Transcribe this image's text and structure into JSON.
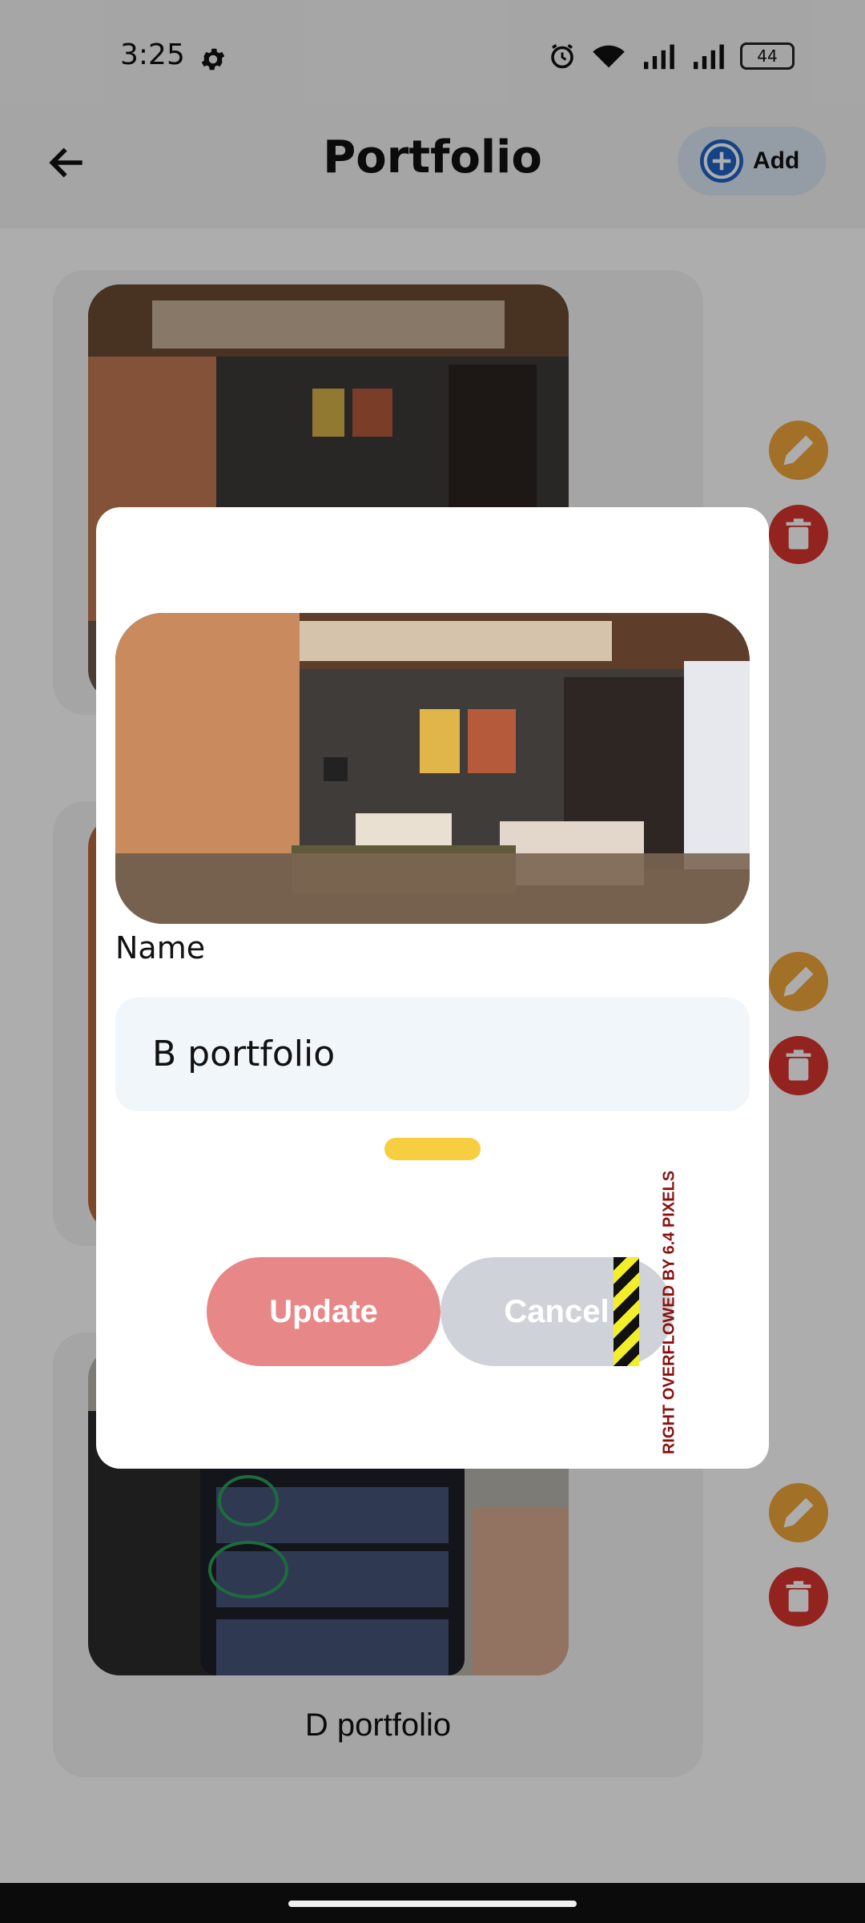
{
  "status": {
    "time": "3:25",
    "battery": "44"
  },
  "app_bar": {
    "title": "Portfolio",
    "add_label": "Add"
  },
  "cards": [
    {
      "name": ""
    },
    {
      "name": ""
    },
    {
      "name": "D portfolio"
    }
  ],
  "dialog": {
    "name_label": "Name",
    "name_value": "B portfolio",
    "update_label": "Update",
    "cancel_label": "Cancel",
    "overflow_message": "RIGHT OVERFLOWED BY 6.4 PIXELS"
  },
  "colors": {
    "accent_blue": "#1f63c9",
    "edit": "#f0a63a",
    "delete": "#d8342f",
    "update_button": "#e88787",
    "cancel_button": "#cfd3d9",
    "pill": "#f6ce3f"
  },
  "icons": [
    "gear-icon",
    "alarm-icon",
    "wifi-icon",
    "signal-icon",
    "back-arrow-icon",
    "add-circle-icon",
    "pencil-icon",
    "trash-icon"
  ]
}
